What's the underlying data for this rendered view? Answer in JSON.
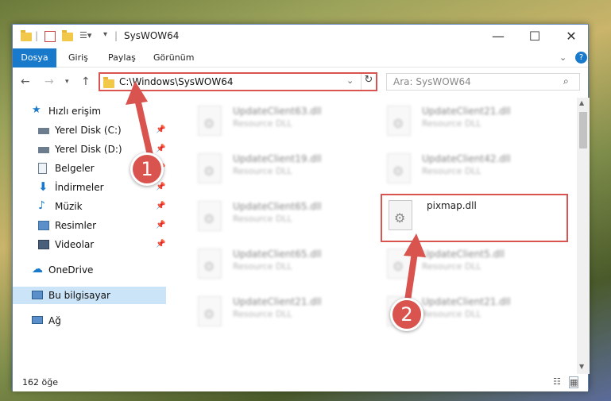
{
  "window": {
    "title": "SysWOW64",
    "controls": {
      "minimize": "—",
      "maximize": "☐",
      "close": "✕"
    }
  },
  "ribbon": {
    "tabs": [
      "Dosya",
      "Giriş",
      "Paylaş",
      "Görünüm"
    ],
    "collapse": "⌄",
    "help": "?"
  },
  "address": {
    "path": "C:\\Windows\\SysWOW64",
    "search_placeholder": "Ara: SysWOW64"
  },
  "nav": {
    "quick_access": "Hızlı erişim",
    "items": [
      {
        "label": "Yerel Disk (C:)",
        "pinned": true
      },
      {
        "label": "Yerel Disk (D:)",
        "pinned": true
      },
      {
        "label": "Belgeler",
        "pinned": true
      },
      {
        "label": "İndirmeler",
        "pinned": true
      },
      {
        "label": "Müzik",
        "pinned": true
      },
      {
        "label": "Resimler",
        "pinned": true
      },
      {
        "label": "Videolar",
        "pinned": true
      }
    ],
    "onedrive": "OneDrive",
    "this_pc": "Bu bilgisayar",
    "network": "Ağ"
  },
  "files": [
    {
      "name": "UpdateClient63.dll",
      "type": "Resource DLL"
    },
    {
      "name": "UpdateClient21.dll",
      "type": "Resource DLL"
    },
    {
      "name": "UpdateClient19.dll",
      "type": "Resource DLL"
    },
    {
      "name": "UpdateClient42.dll",
      "type": "Resource DLL"
    },
    {
      "name": "UpdateClient65.dll",
      "type": "Resource DLL"
    },
    {
      "name": "pixmap.dll",
      "type": ""
    },
    {
      "name": "UpdateClient65.dll",
      "type": "Resource DLL"
    },
    {
      "name": "UpdateClient5.dll",
      "type": "Resource DLL"
    },
    {
      "name": "UpdateClient21.dll",
      "type": "Resource DLL"
    },
    {
      "name": "UpdateClient21.dll",
      "type": "Resource DLL"
    }
  ],
  "status": {
    "count": "162 öğe"
  },
  "annotations": {
    "one": "1",
    "two": "2"
  },
  "colors": {
    "accent": "#1979ca",
    "highlight": "#d9534f",
    "selected": "#cce4f7"
  }
}
